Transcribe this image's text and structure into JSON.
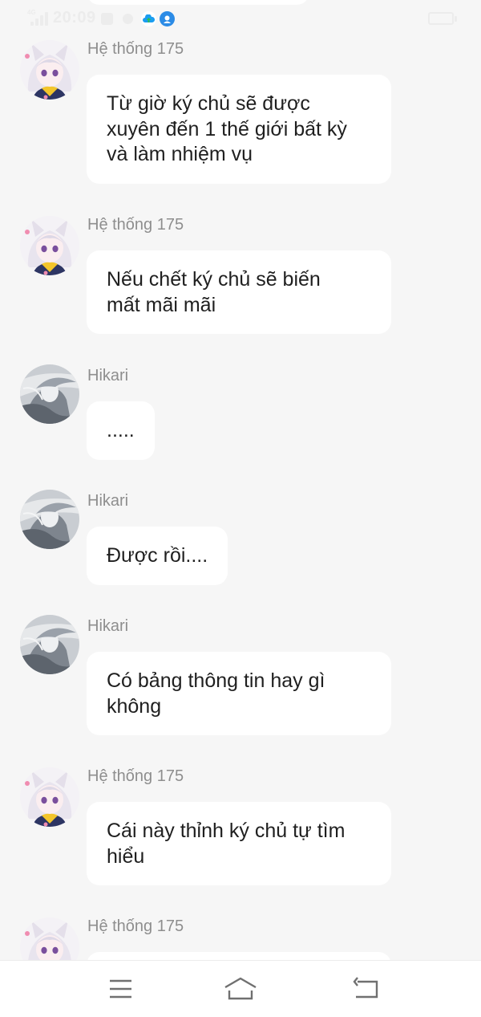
{
  "status_bar": {
    "network_label": "4G",
    "time": "20:09"
  },
  "messages": [
    {
      "sender": "Hệ thống 175",
      "avatar": "anime-girl-cat-ears-avatar",
      "text": "Từ giờ ký chủ sẽ được\nxuyên đến 1 thế giới bất kỳ\nvà làm nhiệm vụ"
    },
    {
      "sender": "Hệ thống 175",
      "avatar": "anime-girl-cat-ears-avatar",
      "text": "Nếu chết ký chủ sẽ biến\nmất mãi mãi"
    },
    {
      "sender": "Hikari",
      "avatar": "grey-windblown-girl-avatar",
      "text": "....."
    },
    {
      "sender": "Hikari",
      "avatar": "grey-windblown-girl-avatar",
      "text": "Được rồi...."
    },
    {
      "sender": "Hikari",
      "avatar": "grey-windblown-girl-avatar",
      "text": "Có bảng thông tin hay gì\nkhông"
    },
    {
      "sender": "Hệ thống 175",
      "avatar": "anime-girl-cat-ears-avatar",
      "text": "Cái này thỉnh ký chủ tự tìm\nhiểu"
    },
    {
      "sender": "Hệ thống 175",
      "avatar": "anime-girl-cat-ears-avatar",
      "text": ""
    }
  ],
  "nav": {
    "menu": "menu-icon",
    "home": "home-icon",
    "back": "back-icon"
  },
  "colors": {
    "background": "#f6f6f6",
    "bubble": "#ffffff",
    "sender_name": "#8e8e8e",
    "message_text": "#1f1f1f"
  }
}
